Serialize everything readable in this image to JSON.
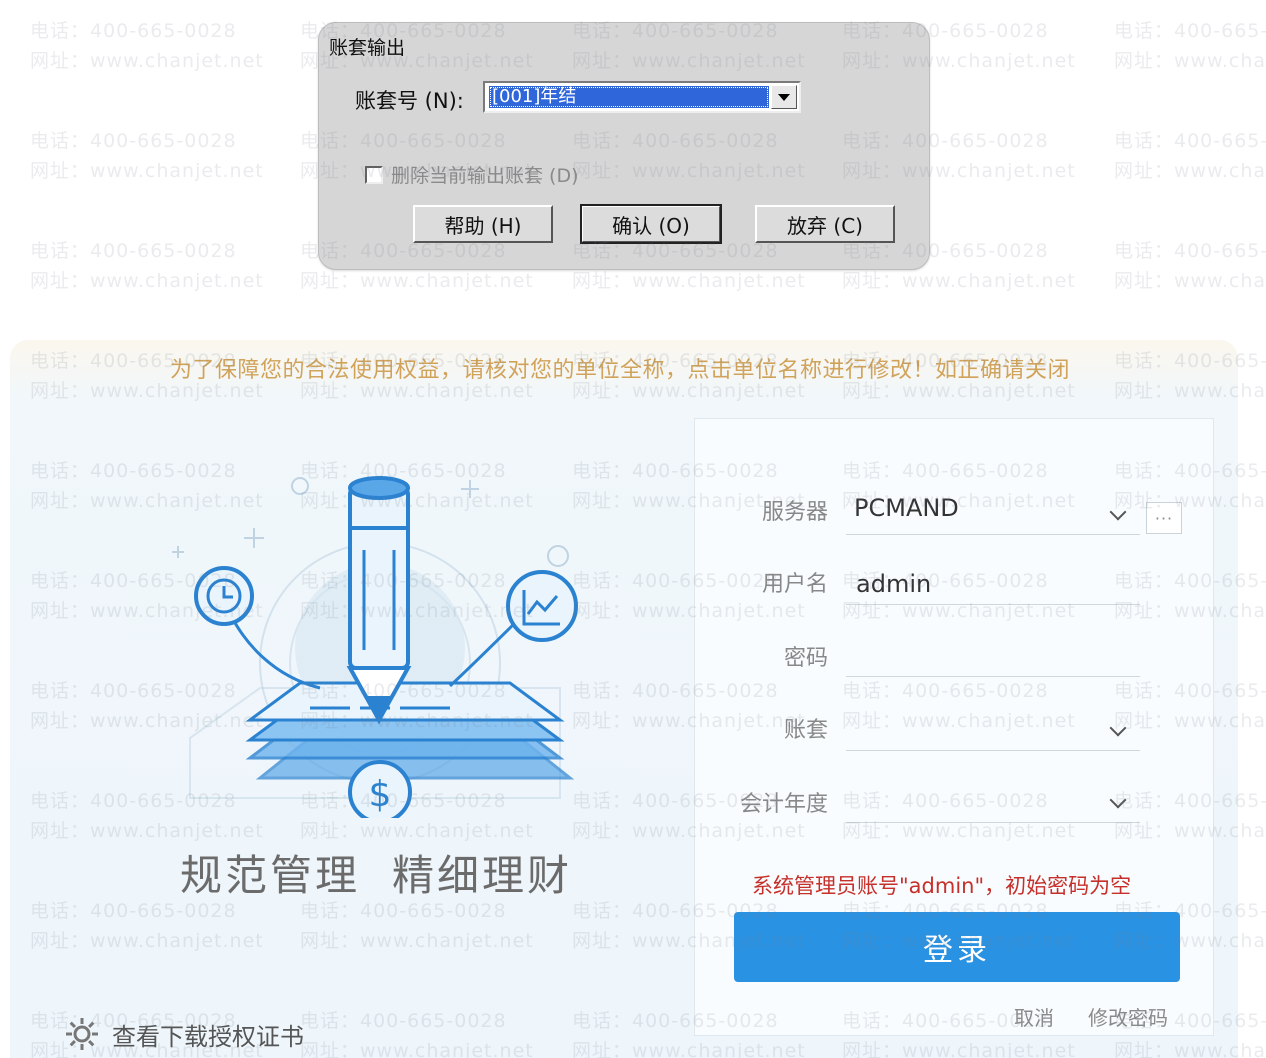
{
  "dialog": {
    "title": "账套输出",
    "account_label": "账套号 (N):",
    "account_value": "[001]年结",
    "delete_checkbox_label": "删除当前输出账套 (D)",
    "delete_checked": false,
    "buttons": {
      "help": "帮助 (H)",
      "confirm": "确认 (O)",
      "cancel": "放弃 (C)"
    }
  },
  "login": {
    "banner": "为了保障您的合法使用权益，请核对您的单位全称，点击单位名称进行修改！如正确请关闭",
    "slogan": [
      "规范管理",
      "精细理财"
    ],
    "server_label": "服务器",
    "server_value": "PCMAND",
    "server_more": "···",
    "username_label": "用户名",
    "username_value": "admin",
    "password_label": "密码",
    "password_value": "",
    "account_set_label": "账套",
    "account_set_value": "",
    "fiscal_year_label": "会计年度",
    "fiscal_year_value": "",
    "hint": "系统管理员账号\"admin\"，初始密码为空",
    "login_button": "登录",
    "cancel_link": "取消",
    "change_password_link": "修改密码",
    "download_link": "查看下载授权证书",
    "colors": {
      "accent": "#2a92e3",
      "hint": "#c6302b",
      "banner": "#d1a35a"
    }
  },
  "watermark": {
    "phone": "电话：400-665-0028",
    "site": "网址：www.chanjet.net"
  }
}
